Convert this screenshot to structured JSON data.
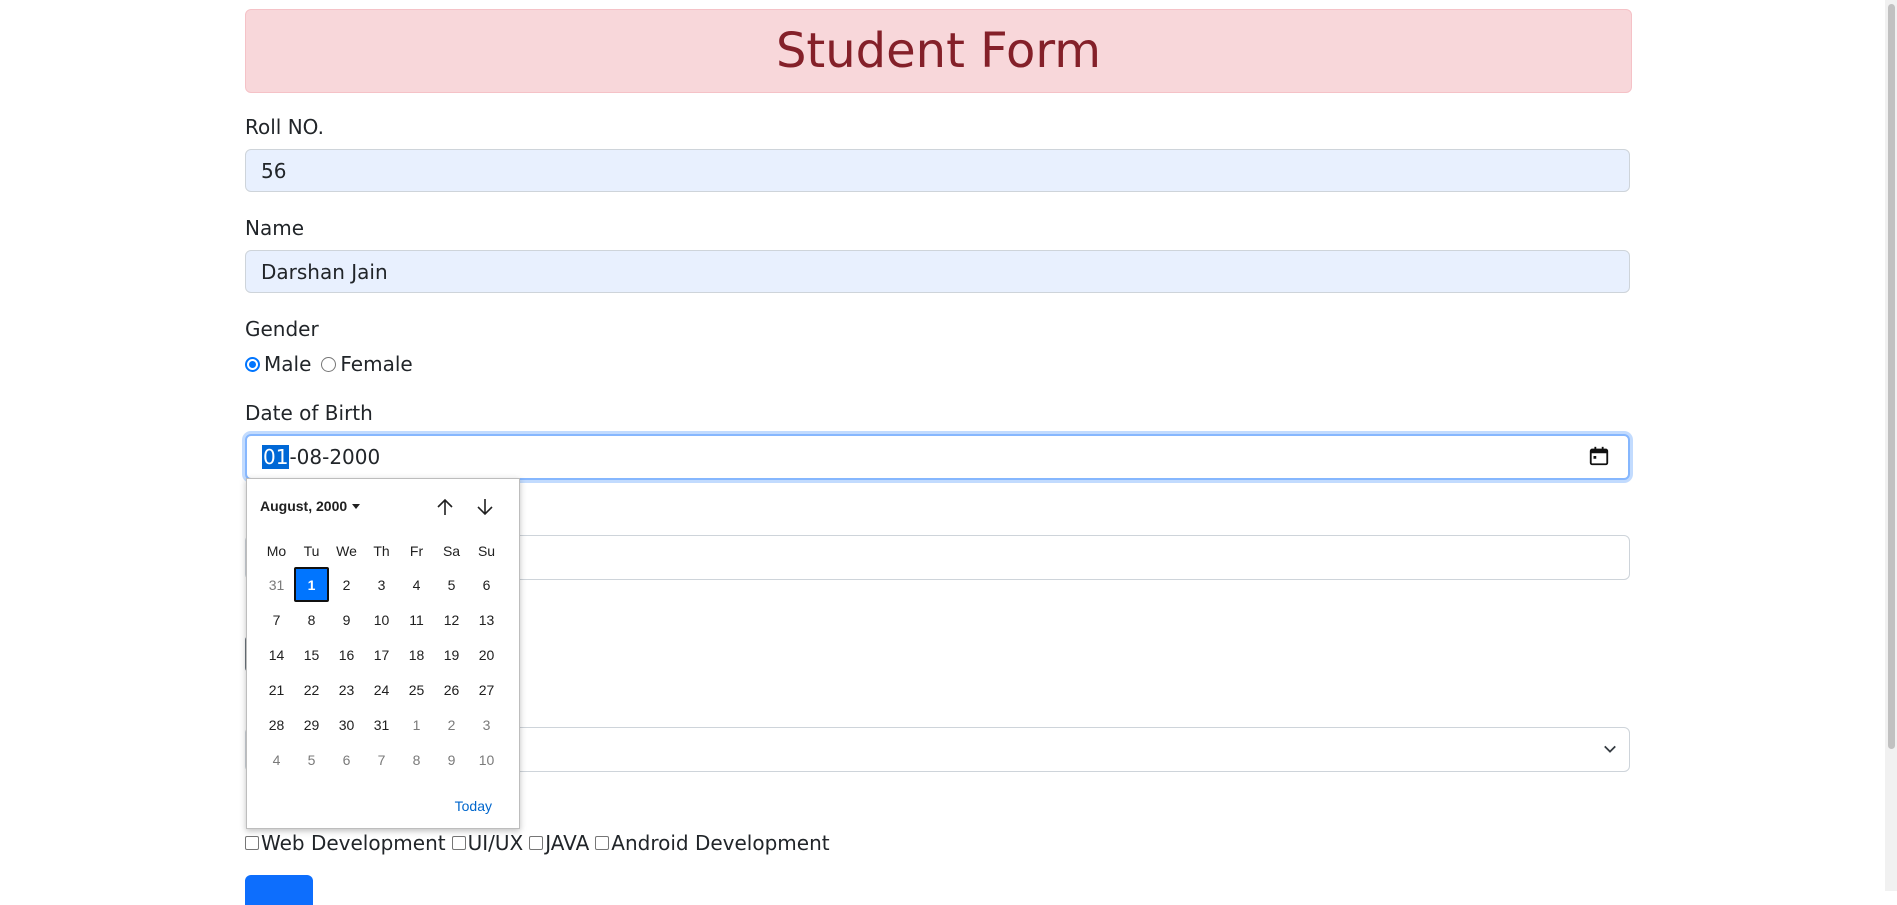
{
  "header": {
    "title": "Student Form"
  },
  "roll": {
    "label": "Roll NO.",
    "value": "56"
  },
  "name": {
    "label": "Name",
    "value": "Darshan Jain"
  },
  "gender": {
    "label": "Gender",
    "options": [
      "Male",
      "Female"
    ],
    "selected": "Male"
  },
  "dob": {
    "label": "Date of Birth",
    "day": "01",
    "rest": "-08-2000"
  },
  "courses": {
    "options": [
      "Web Development",
      "UI/UX",
      "JAVA",
      "Android Development"
    ]
  },
  "calendar": {
    "month_label": "August, 2000",
    "weekdays": [
      "Mo",
      "Tu",
      "We",
      "Th",
      "Fr",
      "Sa",
      "Su"
    ],
    "weeks": [
      [
        "31",
        "1",
        "2",
        "3",
        "4",
        "5",
        "6"
      ],
      [
        "7",
        "8",
        "9",
        "10",
        "11",
        "12",
        "13"
      ],
      [
        "14",
        "15",
        "16",
        "17",
        "18",
        "19",
        "20"
      ],
      [
        "21",
        "22",
        "23",
        "24",
        "25",
        "26",
        "27"
      ],
      [
        "28",
        "29",
        "30",
        "31",
        "1",
        "2",
        "3"
      ],
      [
        "4",
        "5",
        "6",
        "7",
        "8",
        "9",
        "10"
      ]
    ],
    "selected": "1",
    "today_label": "Today"
  },
  "icons": {
    "calendar": "calendar-icon",
    "up": "arrow-up-icon",
    "down": "arrow-down-icon",
    "select": "chevron-down-icon"
  },
  "colors": {
    "accent": "#0d6efd",
    "alert_bg": "#f8d7da",
    "alert_text": "#842029"
  }
}
